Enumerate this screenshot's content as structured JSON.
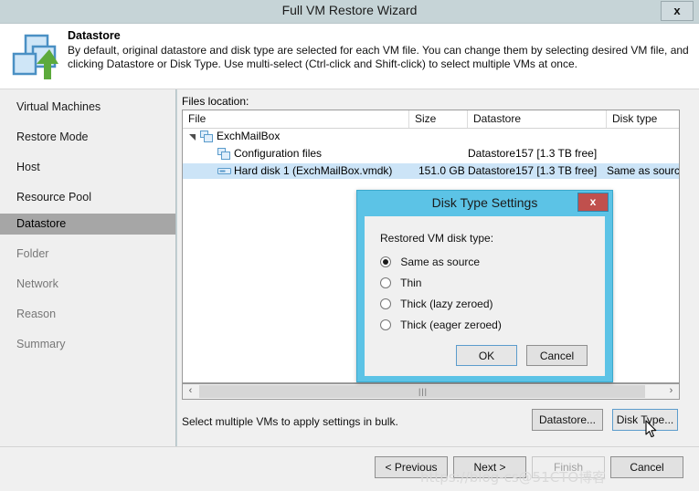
{
  "window": {
    "title": "Full VM Restore Wizard",
    "close_label": "x"
  },
  "header": {
    "icon": "vm-restore-icon",
    "title": "Datastore",
    "description": "By default, original datastore and disk type are selected for each VM file. You can change them by selecting desired VM file, and clicking Datastore or Disk Type. Use multi-select (Ctrl-click and Shift-click) to select multiple VMs at once."
  },
  "sidebar": {
    "items": [
      {
        "label": "Virtual Machines",
        "state": "done"
      },
      {
        "label": "Restore Mode",
        "state": "done"
      },
      {
        "label": "Host",
        "state": "done"
      },
      {
        "label": "Resource Pool",
        "state": "done"
      },
      {
        "label": "Datastore",
        "state": "active"
      },
      {
        "label": "Folder",
        "state": "dim"
      },
      {
        "label": "Network",
        "state": "dim"
      },
      {
        "label": "Reason",
        "state": "dim"
      },
      {
        "label": "Summary",
        "state": "dim"
      }
    ]
  },
  "main": {
    "files_label": "Files location:",
    "columns": [
      "File",
      "Size",
      "Datastore",
      "Disk type"
    ],
    "rows": [
      {
        "file": "ExchMailBox",
        "size": "",
        "datastore": "",
        "disk_type": "",
        "indent": 0,
        "icon": "vm-icon",
        "expander": "expanded",
        "selected": false
      },
      {
        "file": "Configuration files",
        "size": "",
        "datastore": "Datastore157 [1.3 TB free]",
        "disk_type": "",
        "indent": 1,
        "icon": "vm-icon",
        "expander": "none",
        "selected": false
      },
      {
        "file": "Hard disk 1 (ExchMailBox.vmdk)",
        "size": "151.0 GB",
        "datastore": "Datastore157 [1.3 TB free]",
        "disk_type": "Same as source",
        "indent": 1,
        "icon": "disk-icon",
        "expander": "none",
        "selected": true
      }
    ],
    "scrollbar": {
      "left_arrow": "‹",
      "right_arrow": "›",
      "grip": "|||"
    },
    "bulk_hint": "Select multiple VMs to apply settings in bulk.",
    "datastore_button": "Datastore...",
    "disk_type_button": "Disk Type..."
  },
  "footer": {
    "previous": "< Previous",
    "next": "Next >",
    "finish": "Finish",
    "cancel": "Cancel",
    "watermark": "https://blog-cs@51CTO博客"
  },
  "dialog": {
    "title": "Disk Type Settings",
    "close_label": "x",
    "legend": "Restored VM disk type:",
    "options": [
      {
        "label": "Same as source",
        "selected": true
      },
      {
        "label": "Thin",
        "selected": false
      },
      {
        "label": "Thick (lazy zeroed)",
        "selected": false
      },
      {
        "label": "Thick (eager zeroed)",
        "selected": false
      }
    ],
    "ok": "OK",
    "cancel": "Cancel"
  },
  "colors": {
    "window_chrome": "#c6d4d7",
    "dialog_accent": "#5cc3e6",
    "dialog_close": "#c0504d",
    "selected_row": "#cce4f7",
    "active_nav": "#a6a6a6",
    "focus_border": "#5c9ccc"
  }
}
